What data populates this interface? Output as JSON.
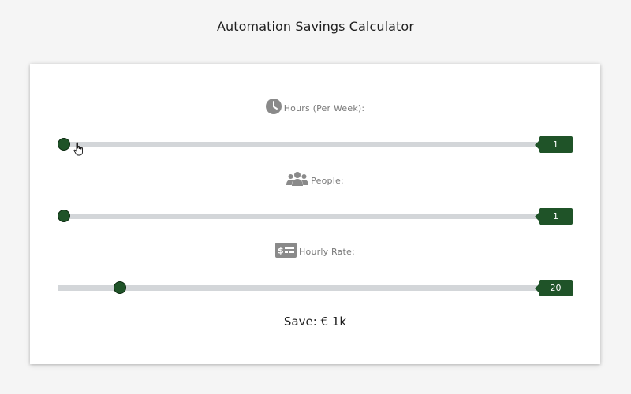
{
  "page": {
    "title": "Automation Savings Calculator"
  },
  "calculator": {
    "sliders": [
      {
        "id": "hours",
        "icon": "clock-icon",
        "label": "Hours (Per Week):",
        "value": 1,
        "value_display": "1",
        "min": 1,
        "max": 40,
        "fraction": 0.0
      },
      {
        "id": "people",
        "icon": "people-icon",
        "label": "People:",
        "value": 1,
        "value_display": "1",
        "min": 1,
        "max": 50,
        "fraction": 0.0
      },
      {
        "id": "hourly_rate",
        "icon": "money-check-icon",
        "label": "Hourly Rate:",
        "value": 20,
        "value_display": "20",
        "min": 0,
        "max": 150,
        "fraction": 0.12
      }
    ],
    "savings_text": "Save: € 1k"
  },
  "colors": {
    "accent": "#1f5328",
    "track": "#d3d6d9",
    "label": "#7a7a7a",
    "icon": "#8a8a8a"
  }
}
